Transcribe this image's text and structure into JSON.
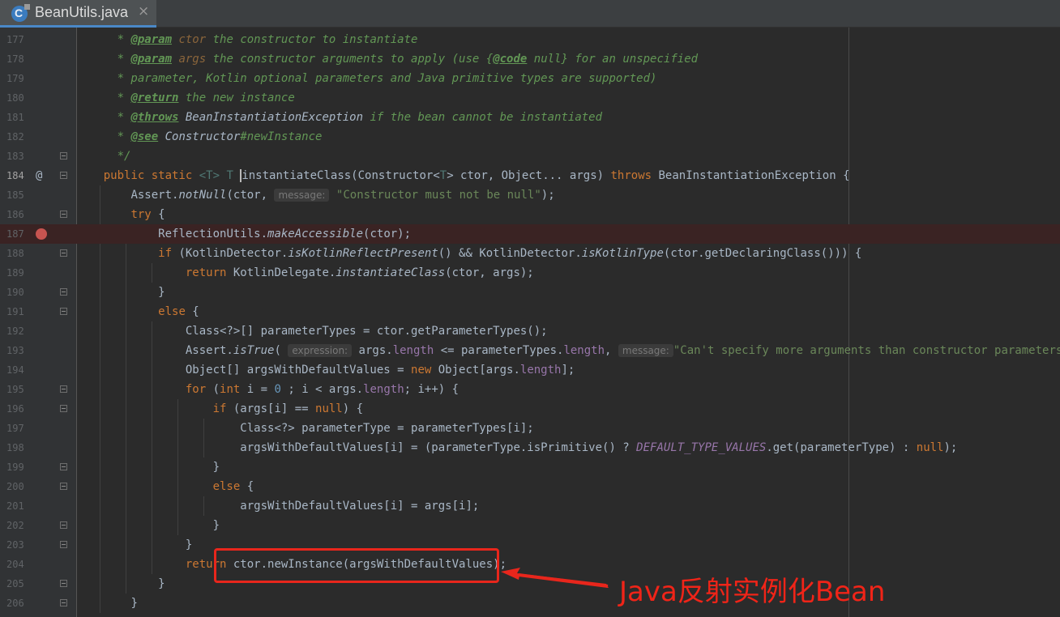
{
  "tab": {
    "title": "BeanUtils.java",
    "close_label": "×",
    "icon": "java-class-icon"
  },
  "gutter": {
    "caret_line": "184",
    "breakpoint_line": "187"
  },
  "hints": {
    "message": "message:",
    "expression": "expression:"
  },
  "code": {
    "l177": {
      "num": "177",
      "p1": "* ",
      "tag": "@param",
      "p2": " ",
      "v": "ctor",
      "p3": " the constructor to instantiate"
    },
    "l178": {
      "num": "178",
      "p1": "* ",
      "tag": "@param",
      "p2": " ",
      "v": "args",
      "p3": " the constructor arguments to apply (use {",
      "tag2": "@code",
      "p4": " null} for an unspecified"
    },
    "l179": {
      "num": "179",
      "t": "* parameter, Kotlin optional parameters and Java primitive types are supported)"
    },
    "l180": {
      "num": "180",
      "p1": "* ",
      "tag": "@return",
      "p3": " the new instance"
    },
    "l181": {
      "num": "181",
      "p1": "* ",
      "tag": "@throws",
      "r": " BeanInstantiationException",
      "p3": " if the bean cannot be instantiated"
    },
    "l182": {
      "num": "182",
      "p1": "* ",
      "tag": "@see",
      "r": " Constructor",
      "p3": "#newInstance"
    },
    "l183": {
      "num": "183",
      "t": "*/"
    },
    "l184": {
      "num": "184",
      "kw1": "public static ",
      "tp1": "<T> T ",
      "m": "instantiateClass",
      "a1": "(Constructor<",
      "tp2": "T",
      "a2": "> ctor, Object... args) ",
      "kw2": "throws",
      "a3": " BeanInstantiationException {"
    },
    "l185": {
      "num": "185",
      "a1": "Assert.",
      "st": "notNull",
      "a2": "(ctor, ",
      "s": "\"Constructor must not be null\"",
      "a3": ");"
    },
    "l186": {
      "num": "186",
      "kw": "try",
      "a1": " {"
    },
    "l187": {
      "num": "187",
      "a1": "ReflectionUtils.",
      "st": "makeAccessible",
      "a2": "(ctor);"
    },
    "l188": {
      "num": "188",
      "kw": "if",
      "a1": " (KotlinDetector.",
      "st": "isKotlinReflectPresent",
      "a2": "() && KotlinDetector.",
      "st2": "isKotlinType",
      "a3": "(ctor.getDeclaringClass())) {"
    },
    "l189": {
      "num": "189",
      "kw": "return",
      "a1": " KotlinDelegate.",
      "st": "instantiateClass",
      "a2": "(ctor, args);"
    },
    "l190": {
      "num": "190",
      "a1": "}"
    },
    "l191": {
      "num": "191",
      "kw": "else",
      "a1": " {"
    },
    "l192": {
      "num": "192",
      "a1": "Class<?>[] parameterTypes = ctor.getParameterTypes();"
    },
    "l193": {
      "num": "193",
      "a1": "Assert.",
      "st": "isTrue",
      "a2": "(",
      "a3": "args.",
      "f1": "length",
      "a4": " <= parameterTypes.",
      "f2": "length",
      "a5": ", ",
      "s": "\"Can't specify more arguments than constructor parameters\"",
      "a6": ");"
    },
    "l194": {
      "num": "194",
      "a1": "Object[] argsWithDefaultValues = ",
      "kw": "new",
      "a2": " Object[args.",
      "f": "length",
      "a3": "];"
    },
    "l195": {
      "num": "195",
      "kw": "for",
      "a1": " (",
      "kw2": "int",
      "a2": " i = ",
      "n": "0",
      "a3": " ; i < args.",
      "f": "length",
      "a4": "; i++) {"
    },
    "l196": {
      "num": "196",
      "kw": "if",
      "a1": " (args[i] == ",
      "kw2": "null",
      "a2": ") {"
    },
    "l197": {
      "num": "197",
      "a1": "Class<?> parameterType = parameterTypes[i];"
    },
    "l198": {
      "num": "198",
      "a1": "argsWithDefaultValues[i] = (parameterType.isPrimitive() ? ",
      "c": "DEFAULT_TYPE_VALUES",
      "a2": ".get(parameterType) : ",
      "kw": "null",
      "a3": ");"
    },
    "l199": {
      "num": "199",
      "a1": "}"
    },
    "l200": {
      "num": "200",
      "kw": "else",
      "a1": " {"
    },
    "l201": {
      "num": "201",
      "a1": "argsWithDefaultValues[i] = args[i];"
    },
    "l202": {
      "num": "202",
      "a1": "}"
    },
    "l203": {
      "num": "203",
      "a1": "}"
    },
    "l204": {
      "num": "204",
      "kw": "return",
      "a1": " ctor.newInstance(argsWithDefaultValues);"
    },
    "l205": {
      "num": "205",
      "a1": "}"
    },
    "l206": {
      "num": "206",
      "a1": "}"
    }
  },
  "annotation": {
    "text": "Java反射实例化Bean",
    "color": "#e8261c"
  },
  "colors": {
    "keyword": "#cc7832",
    "string": "#6a8759",
    "javadoc": "#629755",
    "field": "#9876aa",
    "text": "#a9b7c6",
    "background": "#2b2b2b",
    "gutter": "#313335"
  }
}
